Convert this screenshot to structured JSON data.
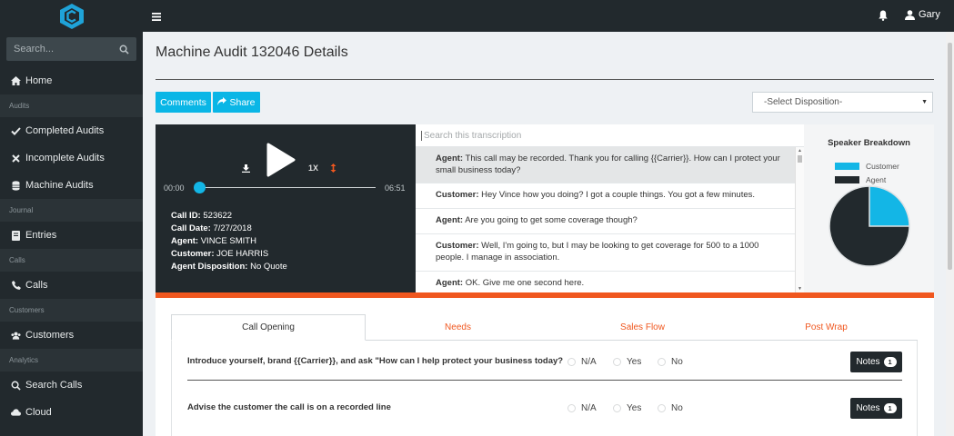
{
  "sidebar": {
    "search_placeholder": "Search...",
    "home": "Home",
    "sections": {
      "audits": "Audits",
      "journal": "Journal",
      "calls": "Calls",
      "customers": "Customers",
      "analytics": "Analytics"
    },
    "items": {
      "completed_audits": "Completed Audits",
      "incomplete_audits": "Incomplete Audits",
      "machine_audits": "Machine Audits",
      "entries": "Entries",
      "calls": "Calls",
      "customers": "Customers",
      "search_calls": "Search Calls",
      "cloud": "Cloud"
    }
  },
  "topbar": {
    "user_name": "Gary"
  },
  "main": {
    "title": "Machine Audit 132046 Details",
    "comments_label": "Comments",
    "share_label": "Share",
    "disposition_placeholder": "-Select Disposition-"
  },
  "player": {
    "speed": "1X",
    "time_current": "00:00",
    "time_total": "06:51",
    "progress": 0,
    "call_id_label": "Call ID:",
    "call_id": "523622",
    "call_date_label": "Call Date:",
    "call_date": "7/27/2018",
    "agent_label": "Agent:",
    "agent": "VINCE SMITH",
    "customer_label": "Customer:",
    "customer": "JOE HARRIS",
    "disposition_label": "Agent Disposition:",
    "disposition": "No Quote"
  },
  "transcript": {
    "search_placeholder": "Search this transcription",
    "lines": [
      {
        "speaker": "Agent:",
        "text": "This call may be recorded. Thank you for calling {{Carrier}}. How can I protect your small business today?"
      },
      {
        "speaker": "Customer:",
        "text": "Hey Vince how you doing? I got a couple things. You got a few minutes."
      },
      {
        "speaker": "Agent:",
        "text": "Are you going to get some coverage though?"
      },
      {
        "speaker": "Customer:",
        "text": "Well, I'm going to, but I may be looking to get coverage for 500 to a 1000 people. I manage in association."
      },
      {
        "speaker": "Agent:",
        "text": "OK. Give me one second here."
      }
    ]
  },
  "speaker_breakdown": {
    "title": "Speaker Breakdown",
    "customer_label": "Customer",
    "agent_label": "Agent",
    "customer_color": "#13b6e6",
    "agent_color": "#22292d",
    "customer_fraction": 0.25
  },
  "checklist": {
    "tabs": {
      "call_opening": "Call Opening",
      "needs": "Needs",
      "sales_flow": "Sales Flow",
      "post_wrap": "Post Wrap"
    },
    "na_label": "N/A",
    "yes_label": "Yes",
    "no_label": "No",
    "notes_label": "Notes",
    "questions": [
      {
        "text": "Introduce yourself, brand {{Carrier}}, and ask \"How can I help protect your business today?",
        "notes_count": "1"
      },
      {
        "text": "Advise the customer the call is on a recorded line",
        "notes_count": "1"
      }
    ]
  }
}
